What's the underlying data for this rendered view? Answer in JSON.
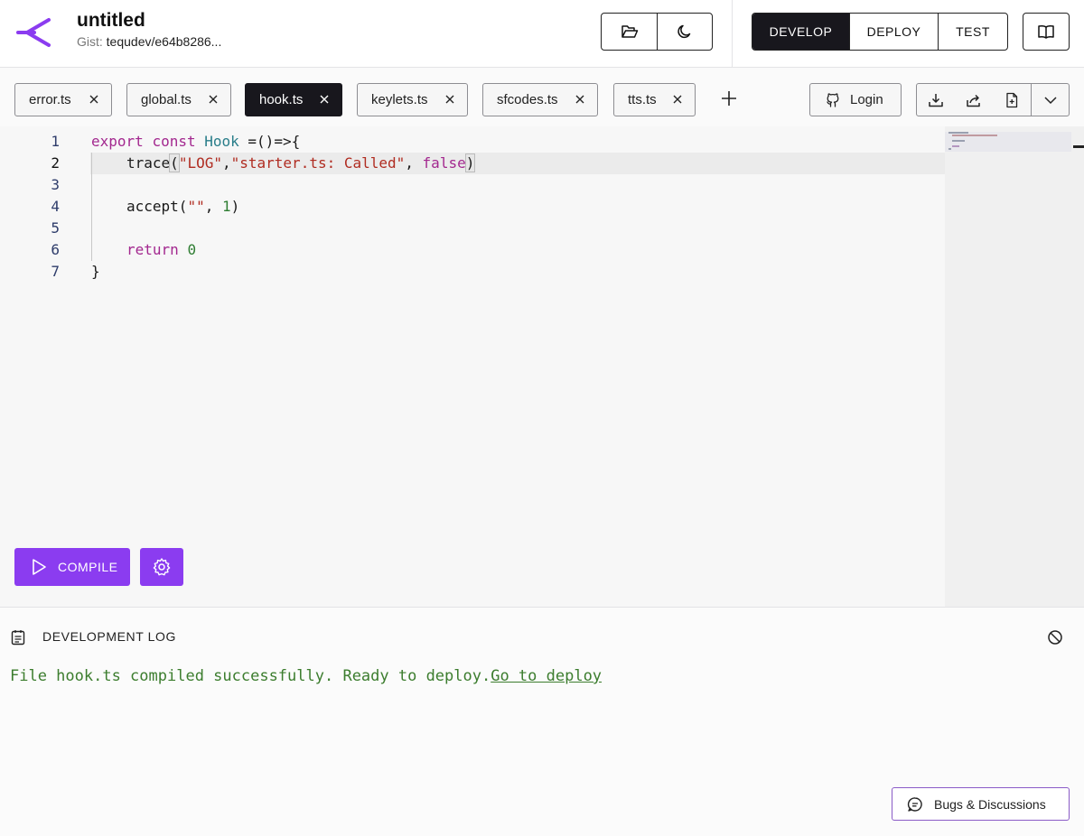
{
  "header": {
    "title": "untitled",
    "gist_label": "Gist:",
    "gist_value": "tequdev/e64b8286...",
    "icons": [
      "folder-open-icon",
      "moon-icon",
      "book-icon"
    ],
    "modes": [
      {
        "label": "DEVELOP",
        "active": true
      },
      {
        "label": "DEPLOY",
        "active": false
      },
      {
        "label": "TEST",
        "active": false
      }
    ]
  },
  "tabs": [
    {
      "label": "error.ts",
      "active": false
    },
    {
      "label": "global.ts",
      "active": false
    },
    {
      "label": "hook.ts",
      "active": true
    },
    {
      "label": "keylets.ts",
      "active": false
    },
    {
      "label": "sfcodes.ts",
      "active": false
    },
    {
      "label": "tts.ts",
      "active": false
    }
  ],
  "toolbar": {
    "login_label": "Login",
    "file_action_icons": [
      "download-icon",
      "share-icon",
      "new-file-icon",
      "chevron-down-icon"
    ]
  },
  "editor": {
    "line_numbers": [
      "1",
      "2",
      "3",
      "4",
      "5",
      "6",
      "7"
    ],
    "current_line": 2,
    "code": {
      "l1_kw1": "export",
      "l1_kw2": "const",
      "l1_type": "Hook",
      "l1_rest": " =()=>{",
      "l2_fn": "trace",
      "l2_open": "(",
      "l2_str1": "\"LOG\"",
      "l2_comma1": ",",
      "l2_str2": "\"starter.ts: Called\"",
      "l2_comma2": ", ",
      "l2_bool": "false",
      "l2_close": ")",
      "l4_fn": "accept(",
      "l4_str": "\"\"",
      "l4_comma": ", ",
      "l4_num": "1",
      "l4_close": ")",
      "l6_kw": "return",
      "l6_num": "0",
      "l7": "}"
    }
  },
  "actions": {
    "compile_label": "COMPILE"
  },
  "log": {
    "title": "DEVELOPMENT LOG",
    "message": "File hook.ts compiled successfully. Ready to deploy.",
    "link": "Go to deploy"
  },
  "footer": {
    "bugs_label": "Bugs & Discussions"
  },
  "colors": {
    "accent": "#8b3cf0",
    "dark": "#18171d",
    "log_success": "#3c7d2e"
  }
}
